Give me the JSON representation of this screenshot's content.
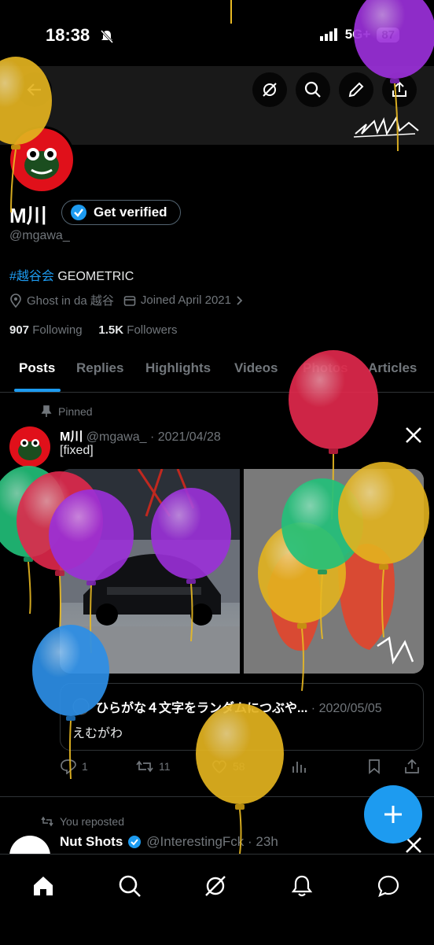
{
  "status_bar": {
    "time": "18:38",
    "network": "5G+",
    "battery": "87"
  },
  "header": {
    "back_icon": "arrow-left-icon",
    "signature_text": "ﾖﾑﾑﾊ"
  },
  "profile": {
    "name": "M川",
    "verify_label": "Get verified",
    "handle": "@mgawa_",
    "bio_tag": "#越谷会",
    "bio_text": " GEOMETRIC",
    "location": "Ghost in da 越谷",
    "joined": "Joined April 2021",
    "following_count": "907",
    "following_label": "Following",
    "followers_count": "1.5K",
    "followers_label": "Followers"
  },
  "tabs": [
    "Posts",
    "Replies",
    "Highlights",
    "Videos",
    "Photos",
    "Articles"
  ],
  "pinned_post": {
    "pinned_label": "Pinned",
    "author": "M川",
    "handle_date": "@mgawa_ · 2021/04/28",
    "text": "[fixed]",
    "quote_author": "ひらがな４文字をランダムにつぶや...",
    "quote_date": " · 2020/05/05",
    "quote_text": "えむがわ",
    "replies": "1",
    "reposts": "11",
    "likes": "58"
  },
  "second_post": {
    "repost_label": "You reposted",
    "author": "Nut Shots",
    "handle_time": "@InterestingFck · 23h"
  },
  "colors": {
    "accent": "#1d9bf0",
    "background": "#000000"
  }
}
